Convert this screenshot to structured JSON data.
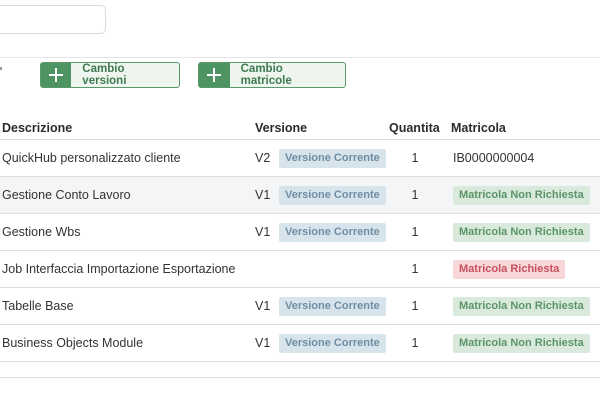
{
  "toolbar": {
    "versions_label": "Cambio versioni",
    "matricole_label": "Cambio matricole"
  },
  "table": {
    "headers": {
      "descrizione": "Descrizione",
      "versione": "Versione",
      "quantita": "Quantita",
      "matricola": "Matricola"
    },
    "rows": [
      {
        "descrizione": "QuickHub personalizzato cliente",
        "versione": "V2",
        "stato_versione": "Versione Corrente",
        "quantita": "1",
        "matricola": "IB0000000004"
      },
      {
        "descrizione": "Gestione Conto Lavoro",
        "versione": "V1",
        "stato_versione": "Versione Corrente",
        "quantita": "1",
        "matricola": "Matricola Non Richiesta"
      },
      {
        "descrizione": "Gestione Wbs",
        "versione": "V1",
        "stato_versione": "Versione Corrente",
        "quantita": "1",
        "matricola": "Matricola Non Richiesta"
      },
      {
        "descrizione": "Job Interfaccia Importazione Esportazione",
        "versione": "",
        "stato_versione": "",
        "quantita": "1",
        "matricola": "Matricola Richiesta"
      },
      {
        "descrizione": "Tabelle Base",
        "versione": "V1",
        "stato_versione": "Versione Corrente",
        "quantita": "1",
        "matricola": "Matricola Non Richiesta"
      },
      {
        "descrizione": "Business Objects Module",
        "versione": "V1",
        "stato_versione": "Versione Corrente",
        "quantita": "1",
        "matricola": "Matricola Non Richiesta"
      }
    ]
  },
  "colors": {
    "button_green": "#4e9463",
    "badge_version_bg": "#d8e4ec",
    "badge_ok_bg": "#d9eadc",
    "badge_req_bg": "#f8d7d9"
  }
}
